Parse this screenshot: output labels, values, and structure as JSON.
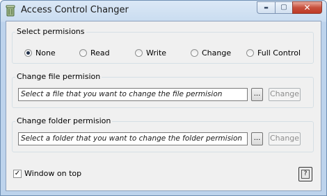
{
  "window": {
    "title": "Access Control Changer",
    "minimize_label": "▬",
    "maximize_label": "▢",
    "close_label": "✕"
  },
  "permissions": {
    "group_title": "Select permisions",
    "options": [
      {
        "label": "None",
        "checked": true
      },
      {
        "label": "Read",
        "checked": false
      },
      {
        "label": "Write",
        "checked": false
      },
      {
        "label": "Change",
        "checked": false
      },
      {
        "label": "Full Control",
        "checked": false
      }
    ]
  },
  "file_section": {
    "group_title": "Change file permision",
    "placeholder": "Select a file that you want to change the file permision",
    "browse_label": "...",
    "change_label": "Change"
  },
  "folder_section": {
    "group_title": "Change folder permision",
    "placeholder": "Select a folder that you want to change the folder permision",
    "browse_label": "...",
    "change_label": "Change"
  },
  "window_on_top": {
    "label": "Window on top",
    "checked": true,
    "check_glyph": "✓"
  },
  "help": {
    "label": "?"
  },
  "icons": {
    "app_icon": "recycle-bin-icon",
    "help_icon": "question-mark-icon"
  }
}
